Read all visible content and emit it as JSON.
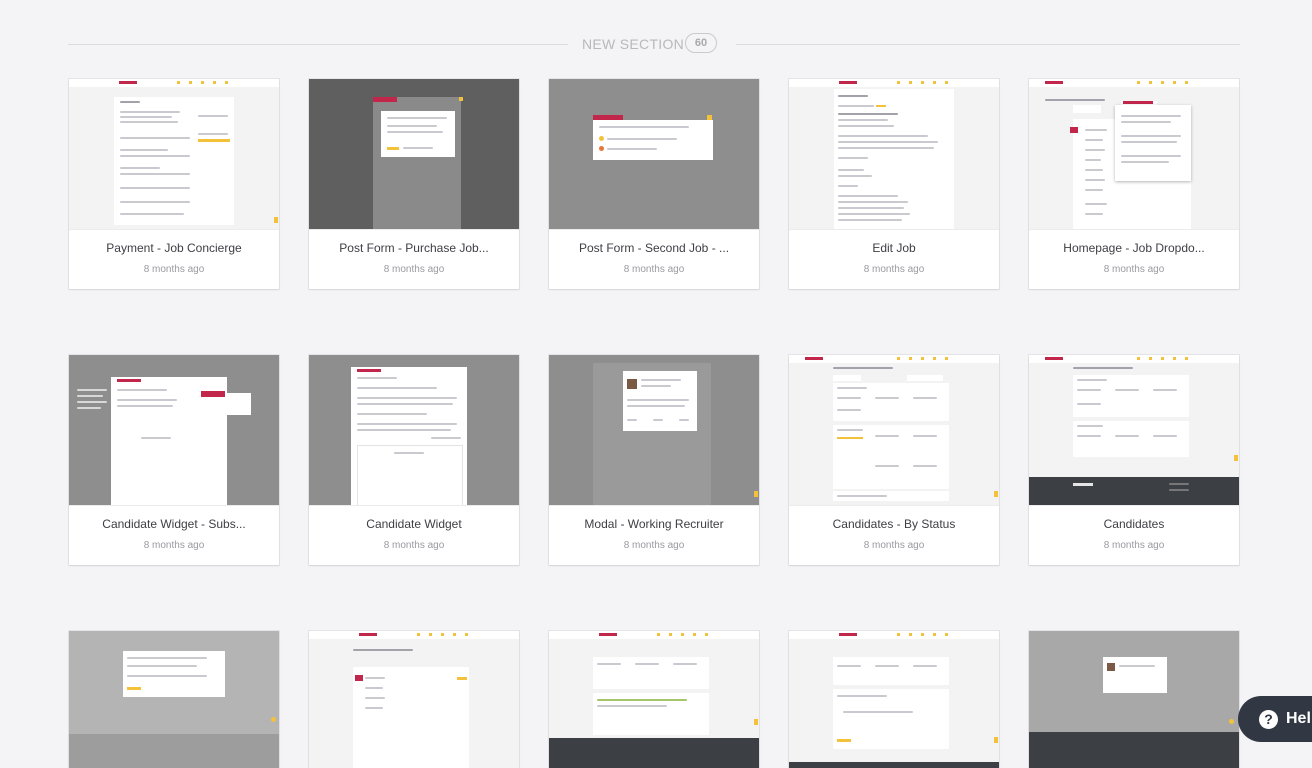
{
  "section": {
    "title": "NEW SECTION",
    "count": "60"
  },
  "cards": [
    {
      "title": "Payment - Job Concierge",
      "time": "8 months ago"
    },
    {
      "title": "Post Form - Purchase Job...",
      "time": "8 months ago"
    },
    {
      "title": "Post Form - Second Job - ...",
      "time": "8 months ago"
    },
    {
      "title": "Edit Job",
      "time": "8 months ago"
    },
    {
      "title": "Homepage - Job Dropdo...",
      "time": "8 months ago"
    },
    {
      "title": "Candidate Widget - Subs...",
      "time": "8 months ago"
    },
    {
      "title": "Candidate Widget",
      "time": "8 months ago"
    },
    {
      "title": "Modal - Working Recruiter",
      "time": "8 months ago"
    },
    {
      "title": "Candidates - By Status",
      "time": "8 months ago"
    },
    {
      "title": "Candidates",
      "time": "8 months ago"
    }
  ],
  "help": {
    "label": "Hel",
    "icon": "question-icon"
  },
  "colors": {
    "accent": "#f3c23a",
    "brand": "#c2264b",
    "background": "#f4f4f6",
    "help_bg": "#313843"
  }
}
